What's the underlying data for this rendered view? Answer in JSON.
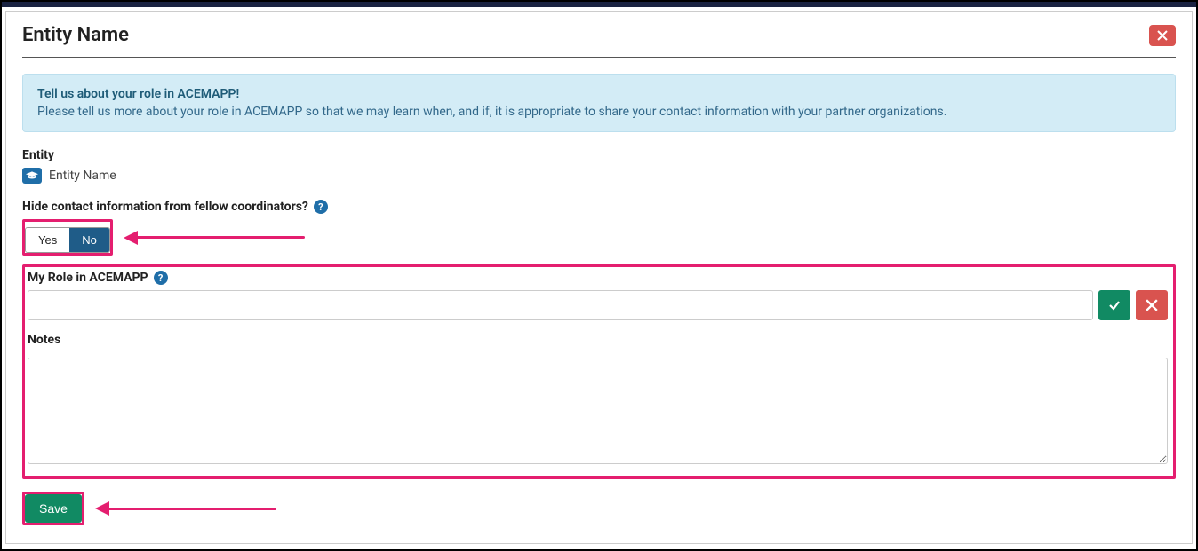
{
  "panel": {
    "title": "Entity Name"
  },
  "info": {
    "title": "Tell us about your role in ACEMAPP!",
    "text": "Please tell us more about your role in ACEMAPP so that we may learn when, and if, it is appropriate to share your contact information with your partner organizations."
  },
  "entity": {
    "label": "Entity",
    "value": "Entity Name"
  },
  "hide_contact": {
    "label": "Hide contact information from fellow coordinators?",
    "yes_label": "Yes",
    "no_label": "No",
    "selected": "no"
  },
  "role": {
    "label": "My Role in ACEMAPP",
    "value": ""
  },
  "notes": {
    "label": "Notes",
    "value": ""
  },
  "actions": {
    "save_label": "Save"
  },
  "help_glyph": "?"
}
